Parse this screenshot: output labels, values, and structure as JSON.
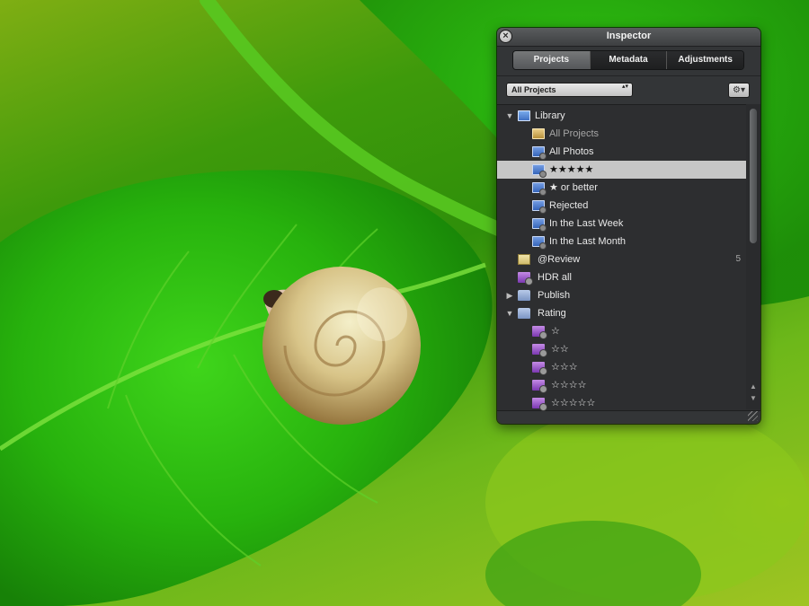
{
  "window": {
    "title": "Inspector"
  },
  "tabs": [
    {
      "label": "Projects",
      "active": true
    },
    {
      "label": "Metadata",
      "active": false
    },
    {
      "label": "Adjustments",
      "active": false
    }
  ],
  "filter": {
    "selected": "All Projects"
  },
  "library": {
    "items": [
      {
        "label": "Library",
        "icon": "library-icon",
        "indent": 0,
        "disclosure": "expanded"
      },
      {
        "label": "All Projects",
        "icon": "projects-icon",
        "indent": 1
      },
      {
        "label": "All Photos",
        "icon": "album-icon",
        "indent": 1
      },
      {
        "label": "★★★★★",
        "icon": "smart-album-icon",
        "indent": 1,
        "selected": true
      },
      {
        "label": "★ or better",
        "icon": "smart-album-icon",
        "indent": 1
      },
      {
        "label": "Rejected",
        "icon": "smart-album-icon",
        "indent": 1
      },
      {
        "label": "In the Last Week",
        "icon": "smart-album-icon",
        "indent": 1
      },
      {
        "label": "In the Last Month",
        "icon": "smart-album-icon",
        "indent": 1
      },
      {
        "label": "@Review",
        "icon": "project-icon",
        "indent": 0,
        "count": "5"
      },
      {
        "label": "HDR all",
        "icon": "smart-album-icon",
        "indent": 0
      },
      {
        "label": "Publish",
        "icon": "folder-icon",
        "indent": 0,
        "disclosure": "collapsed"
      },
      {
        "label": "Rating",
        "icon": "folder-icon",
        "indent": 0,
        "disclosure": "expanded"
      },
      {
        "label": "☆",
        "icon": "smart-album-icon",
        "indent": 1
      },
      {
        "label": "☆☆",
        "icon": "smart-album-icon",
        "indent": 1
      },
      {
        "label": "☆☆☆",
        "icon": "smart-album-icon",
        "indent": 1
      },
      {
        "label": "☆☆☆☆",
        "icon": "smart-album-icon",
        "indent": 1
      },
      {
        "label": "☆☆☆☆☆",
        "icon": "smart-album-icon",
        "indent": 1
      }
    ]
  },
  "glyphs": {
    "close": "×",
    "select_arrows": "▴▾",
    "gear": "⚙▾",
    "expanded": "▼",
    "collapsed": "▶",
    "scroll_up": "▲",
    "scroll_down": "▼"
  },
  "colors": {
    "hud_background": "#333537",
    "selection": "#c6c6c6",
    "wallpaper_green": "#3e9a0b"
  }
}
